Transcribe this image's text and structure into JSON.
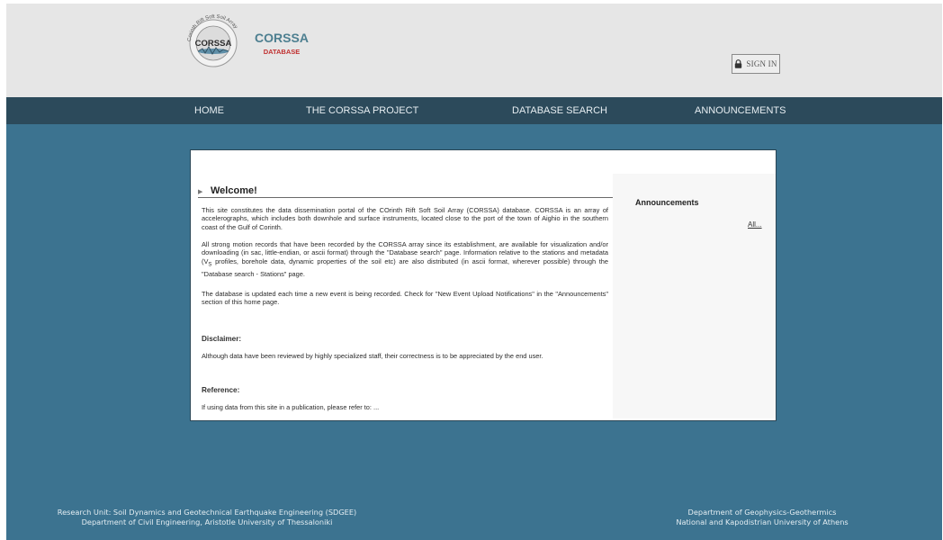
{
  "header": {
    "logo": {
      "badge_text": "CORSSA",
      "ring_text": "Corinth Rift Soft Soil Array",
      "title": "CORSSA",
      "subtitle": "DATABASE"
    },
    "signin_label": "SIGN IN"
  },
  "nav": [
    {
      "label": "HOME"
    },
    {
      "label": "THE CORSSA PROJECT"
    },
    {
      "label": "DATABASE SEARCH"
    },
    {
      "label": "ANNOUNCEMENTS"
    }
  ],
  "main": {
    "welcome_title": "Welcome!",
    "intro": "This site constitutes the data dissemination portal of the COrinth Rift Soft Soil Array (CORSSA) database. CORSSA is an array of accelerographs, which includes both downhole and surface instruments, located close to the port of the town of Aighio in the southern coast of the Gulf of Corinth.",
    "records_part1": "All strong motion records that have been recorded by the CORSSA array since its establishment, are available for visualization and/or downloading (in sac, little-endian, or ascii format) through the \"Database search\" page. Information relative to the stations and metadata (V",
    "records_sub": "S",
    "records_part2": " profiles, borehole data, dynamic properties of the soil etc) are also distributed (in ascii format, wherever possible) through the \"Database search - Stations\" page.",
    "update": "The database is updated each time a new event is being recorded. Check for \"New Event Upload Notifications\" in the \"Announcements\" section of this home page.",
    "disclaimer_heading": "Disclaimer:",
    "disclaimer_text": "Although data have been reviewed by highly specialized staff, their correctness is to be appreciated by the end user.",
    "reference_heading": "Reference:",
    "reference_text": "If using data from this site in a publication, please refer to: ..."
  },
  "sidebar": {
    "title": "Announcements",
    "all_link": "All..."
  },
  "footer": {
    "left": [
      "Research Unit: Soil Dynamics and Geotechnical Earthquake Engineering (SDGEE)",
      "Department of Civil Engineering, Aristotle University of Thessaloniki"
    ],
    "right": [
      "Department of Geophysics-Geothermics",
      "National and Kapodistrian University of Athens"
    ]
  },
  "colors": {
    "page_bg": "#3c7390",
    "header_bg": "#e6e6e6",
    "nav_bg": "#2c4a5b",
    "logo_title": "#4d7f90",
    "logo_subtitle": "#c03030"
  }
}
